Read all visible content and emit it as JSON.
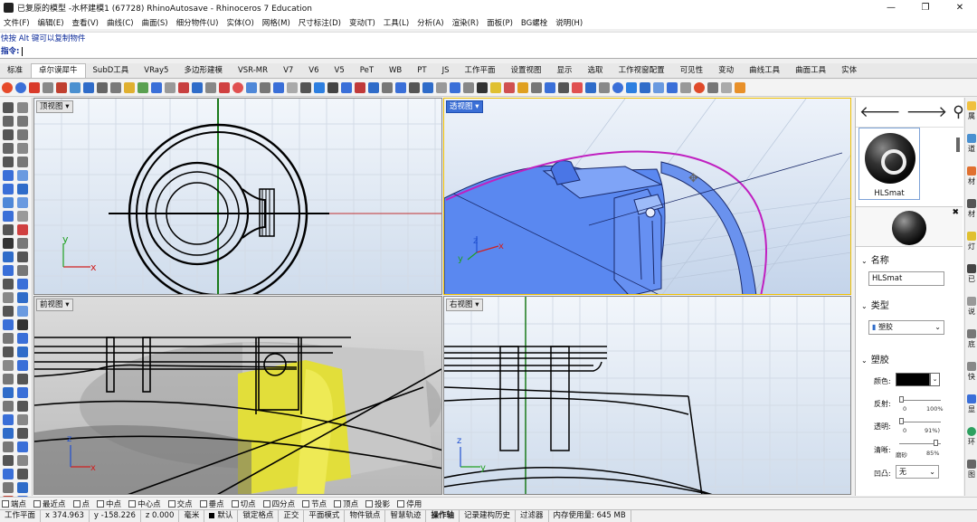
{
  "window": {
    "title": "已复原的模型 -水杯建模1 (67728) RhinoAutosave - Rhinoceros 7 Education",
    "minimize": "—",
    "maximize": "❐",
    "close": "✕"
  },
  "menu": [
    "文件(F)",
    "编辑(E)",
    "查看(V)",
    "曲线(C)",
    "曲面(S)",
    "细分物件(U)",
    "实体(O)",
    "网格(M)",
    "尺寸标注(D)",
    "变动(T)",
    "工具(L)",
    "分析(A)",
    "渲染(R)",
    "面板(P)",
    "BG螺栓",
    "说明(H)"
  ],
  "command": {
    "history": "快按 Alt 键可以复制物件",
    "prompt_label": "指令:",
    "value": ""
  },
  "tabs": [
    "标准",
    "卓尔谟犀牛",
    "SubD工具",
    "VRay5",
    "多边形建模",
    "VSR-MR",
    "V7",
    "V6",
    "V5",
    "PeT",
    "WB",
    "PT",
    "JS",
    "工作平面",
    "设置视图",
    "显示",
    "选取",
    "工作视窗配置",
    "可见性",
    "变动",
    "曲线工具",
    "曲面工具",
    "实体"
  ],
  "active_tab": "卓尔谟犀牛",
  "viewports": {
    "top": {
      "label": "顶视图",
      "dropdown": "▾"
    },
    "perspective": {
      "label": "透视图",
      "dropdown": "▾"
    },
    "front": {
      "label": "前视图",
      "dropdown": "▾"
    },
    "right": {
      "label": "右视图",
      "dropdown": "▾"
    },
    "axis_x": "x",
    "axis_y": "y",
    "axis_z": "z"
  },
  "panel": {
    "nav_back": "🡐",
    "nav_forward": "🡒",
    "search_icon": "⚲",
    "menu_icon": "☰",
    "help": "?",
    "material_name": "HLSmat",
    "close_x": "✖",
    "sec_name": "名称",
    "name_value": "HLSmat",
    "sec_type": "类型",
    "type_value": "塑胶",
    "sec_plastic": "塑胶",
    "color_label": "颜色:",
    "color_value": "#000000",
    "reflect_label": "反射:",
    "reflect_min": "0",
    "reflect_max": "100%",
    "reflect_value": 0,
    "transp_label": "透明:",
    "transp_min": "0",
    "transp_max": "91%)",
    "transp_value": 0.91,
    "clarity_label": "清晰:",
    "clarity_min": "磨砂",
    "clarity_max": "85%",
    "clarity_value": 0.85,
    "bump_label": "凹凸:",
    "bump_value": "无",
    "collapse": "›",
    "expand": "⌄"
  },
  "side_tabs": [
    "属",
    "道",
    "材",
    "材",
    "灯",
    "已",
    "说",
    "底",
    "快",
    "显",
    "环",
    "图"
  ],
  "osnap": [
    {
      "label": "端点",
      "checked": false
    },
    {
      "label": "最近点",
      "checked": false
    },
    {
      "label": "点",
      "checked": false
    },
    {
      "label": "中点",
      "checked": false
    },
    {
      "label": "中心点",
      "checked": false
    },
    {
      "label": "交点",
      "checked": false
    },
    {
      "label": "垂点",
      "checked": false
    },
    {
      "label": "切点",
      "checked": false
    },
    {
      "label": "四分点",
      "checked": false
    },
    {
      "label": "节点",
      "checked": false
    },
    {
      "label": "顶点",
      "checked": false
    },
    {
      "label": "投影",
      "checked": false
    },
    {
      "label": "停用",
      "checked": false
    }
  ],
  "status": {
    "cplane": "工作平面",
    "x": "x 374.963",
    "y": "y -158.226",
    "z": "z 0.000",
    "unit": "毫米",
    "layer": "默认",
    "grid_snap": "锁定格点",
    "ortho": "正交",
    "planar": "平面模式",
    "osnap": "物件锁点",
    "smarttrack": "智慧轨迹",
    "gumball": "操作轴",
    "history": "记录建构历史",
    "filter": "过滤器",
    "memory": "内存使用量: 645 MB"
  }
}
